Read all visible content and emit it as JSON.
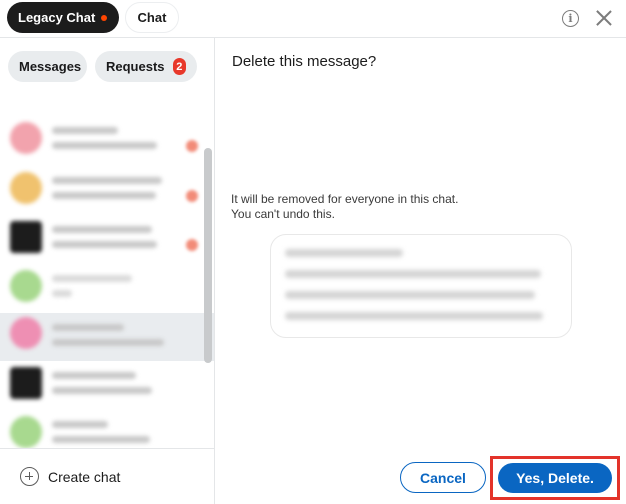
{
  "header": {
    "tabs": [
      {
        "label": "Legacy Chat"
      },
      {
        "label": "Chat"
      }
    ],
    "info_icon": "info-icon",
    "close_icon": "close-icon"
  },
  "sidebar": {
    "filters": [
      {
        "label": "Messages"
      },
      {
        "label": "Requests",
        "badge": "2"
      }
    ],
    "create_label": "Create chat"
  },
  "dialog": {
    "title": "Delete this message?",
    "text_line1": "It will be removed for everyone in this chat.",
    "text_line2": "You can't undo this.",
    "cancel_label": "Cancel",
    "confirm_label": "Yes, Delete."
  },
  "colors": {
    "accent": "#0a66c2",
    "badge": "#e8382a",
    "highlight_box": "#e3332a"
  }
}
